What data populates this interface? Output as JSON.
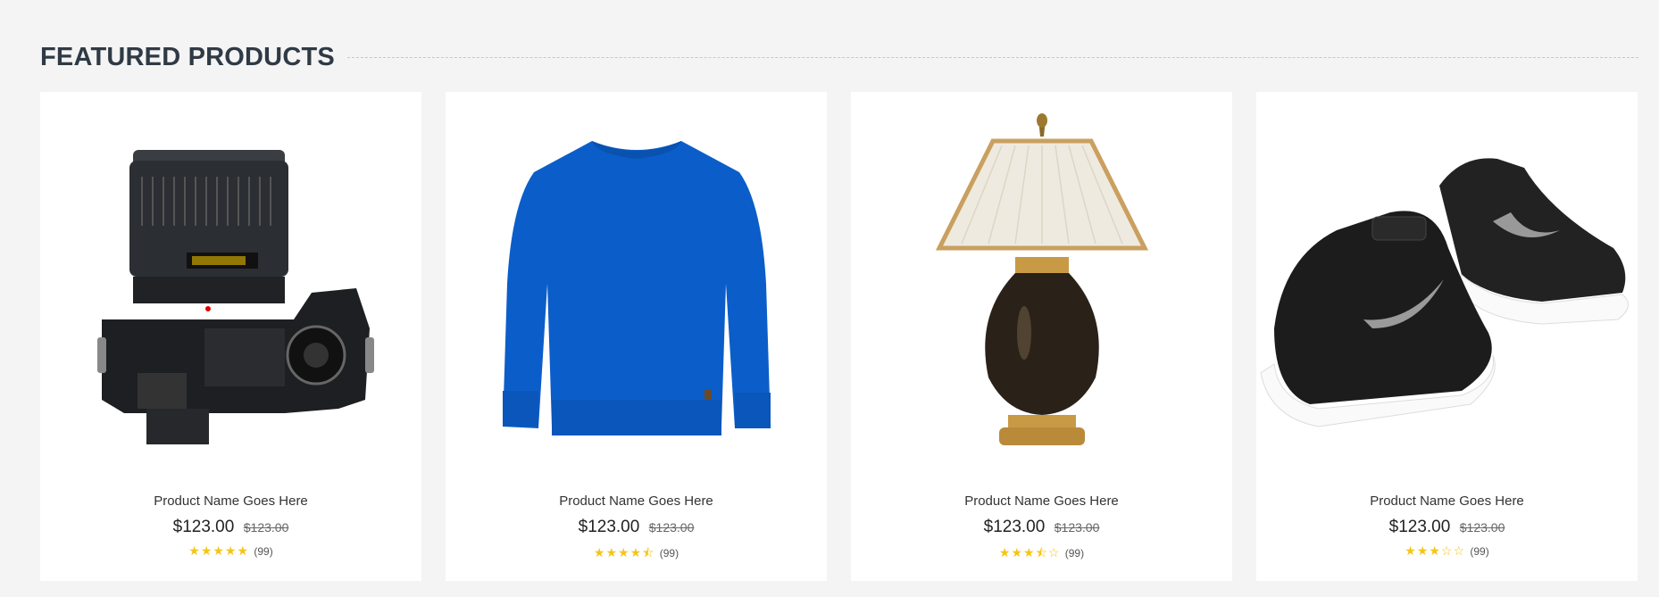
{
  "section": {
    "title": "FEATURED PRODUCTS"
  },
  "products": [
    {
      "image_icon": "camera-icon",
      "name": "Product Name Goes Here",
      "price": "$123.00",
      "old_price": "$123.00",
      "rating_stars": "★★★★★",
      "rating": 5,
      "rating_count": "(99)"
    },
    {
      "image_icon": "sweater-icon",
      "name": "Product Name Goes Here",
      "price": "$123.00",
      "old_price": "$123.00",
      "rating_stars": "★★★★⯪",
      "rating": 4.5,
      "rating_count": "(99)"
    },
    {
      "image_icon": "lamp-icon",
      "name": "Product Name Goes Here",
      "price": "$123.00",
      "old_price": "$123.00",
      "rating_stars": "★★★⯪☆",
      "rating": 3.5,
      "rating_count": "(99)"
    },
    {
      "image_icon": "sneakers-icon",
      "name": "Product Name Goes Here",
      "price": "$123.00",
      "old_price": "$123.00",
      "rating_stars": "★★★☆☆",
      "rating": 3,
      "rating_count": "(99)"
    }
  ],
  "colors": {
    "star": "#f5c518",
    "heading": "#2f3a45",
    "background": "#f4f4f4"
  }
}
